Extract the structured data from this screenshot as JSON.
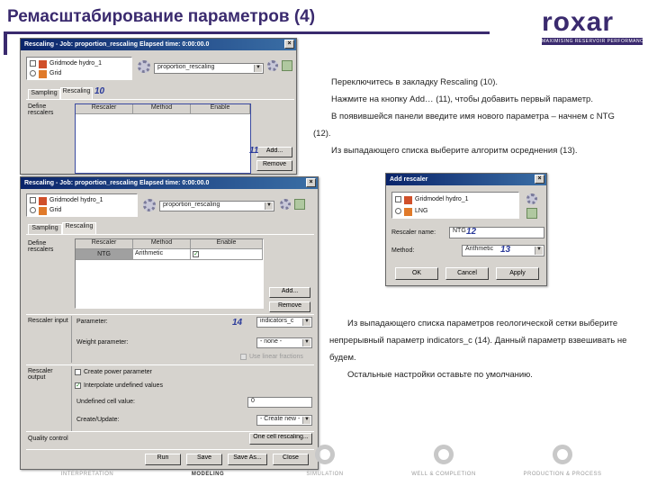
{
  "slide": {
    "title": "Ремасштабирование параметров (4)",
    "logo_word": "roxar",
    "logo_tagline": "MAXIMISING RESERVOIR PERFORMANCE"
  },
  "win1": {
    "title": "Rescaling - Job: proportion_rescaling  Elapsed time: 0:00:00.0",
    "grid_model": "Gridmode hydro_1",
    "grid": "Grid",
    "job_combo": "proportion_rescaling",
    "tab_sampling": "Sampling",
    "tab_rescaling": "Rescaling",
    "define_rescalers": "Define rescalers",
    "col_rescaler": "Rescaler",
    "col_method": "Method",
    "col_enable": "Enable",
    "add": "Add...",
    "remove": "Remove"
  },
  "win2": {
    "title": "Rescaling - Job: proportion_rescaling  Elapsed time: 0:00:00.0",
    "grid_model": "Gridmodel hydro_1",
    "grid": "Grid",
    "job_combo": "proportion_rescaling",
    "tab_sampling": "Sampling",
    "tab_rescaling": "Rescaling",
    "define_rescalers": "Define rescalers",
    "col_rescaler": "Rescaler",
    "col_method": "Method",
    "col_enable": "Enable",
    "row_rescaler": "NTG",
    "row_method": "Arithmetic",
    "add": "Add...",
    "remove": "Remove",
    "rescaler_input": "Rescaler input",
    "parameter_label": "Parameter:",
    "parameter_value": "indicators_c",
    "weight_label": "Weight parameter:",
    "weight_value": "- none -",
    "use_linear": "Use linear fractions",
    "rescaler_output": "Rescaler output",
    "create_power": "Create power parameter",
    "interpolate": "Interpolate undefined values",
    "undefined_label": "Undefined cell value:",
    "undefined_value": "0",
    "create_upscaled": "Create/Update:",
    "create_value": "- Create new -",
    "quality_control": "Quality control",
    "one_cell": "One cell rescaling...",
    "btn_run": "Run",
    "btn_save": "Save",
    "btn_save_as": "Save As...",
    "btn_close": "Close"
  },
  "dialog": {
    "title": "Add rescaler",
    "grid_model": "Gridmodel hydro_1",
    "grid": "LNG",
    "rescaler_name_label": "Rescaler name:",
    "rescaler_name_value": "NTG",
    "method_label": "Method:",
    "method_value": "Arithmetic",
    "btn_ok": "OK",
    "btn_cancel": "Cancel",
    "btn_apply": "Apply"
  },
  "annotations": {
    "a10": "10",
    "a11": "11",
    "a12": "12",
    "a13": "13",
    "a14": "14"
  },
  "instructions_top": [
    "Переключитесь в закладку Rescaling (10).",
    "Нажмите на кнопку Add… (11), чтобы добавить первый параметр.",
    "В появившейся панели введите имя нового параметра – начнем с NTG (12).",
    "Из выпадающего списка выберите алгоритм осреднения (13)."
  ],
  "instructions_bottom": [
    "Из выпадающего списка параметров геологической сетки выберите непрерывный параметр indicators_c (14). Данный параметр взвешивать не будем.",
    "Остальные настройки оставьте по умолчанию."
  ],
  "workflow": {
    "interpretation": "INTERPRETATION",
    "modeling": "MODELING",
    "simulation": "SIMULATION",
    "well_completion": "WELL & COMPLETION",
    "production": "PRODUCTION & PROCESS"
  },
  "colors": {
    "brand": "#3a2a6e",
    "annotation": "#2a3a9a",
    "titlebar": "#0a246a"
  }
}
